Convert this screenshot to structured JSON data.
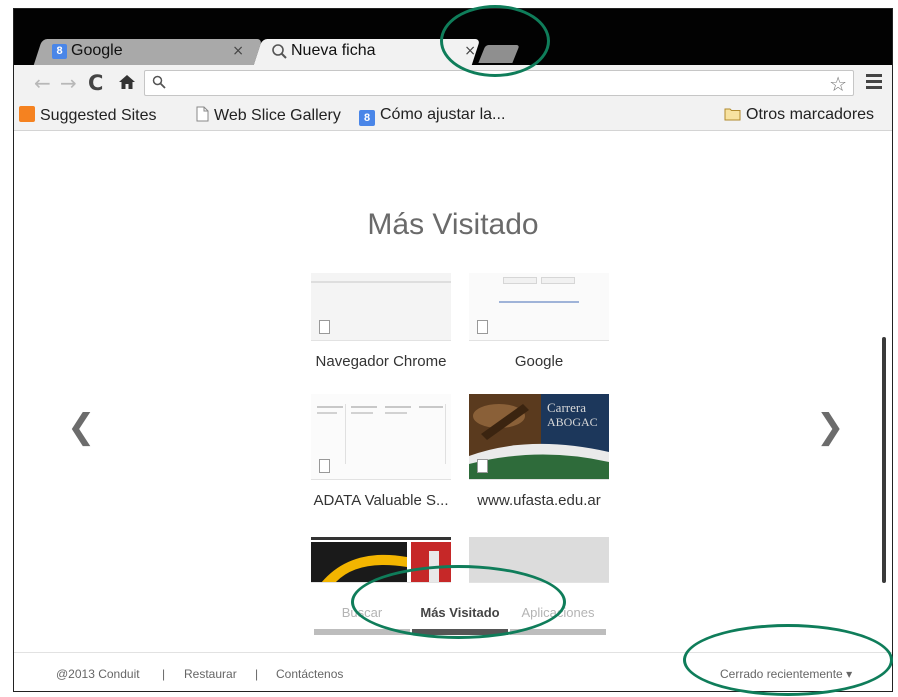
{
  "browser": {
    "tabs": [
      {
        "title": "Google",
        "favicon": "google-g-icon",
        "active": false
      },
      {
        "title": "Nueva ficha",
        "favicon": "search-icon",
        "active": true
      }
    ],
    "tab_close_glyph": "×",
    "omnibox": {
      "value": "",
      "placeholder": ""
    },
    "nav": {
      "back": "←",
      "forward": "→",
      "reload": "C",
      "home": "⌂",
      "star": "☆"
    }
  },
  "bookmarks": {
    "items": [
      {
        "label": "Suggested Sites",
        "icon": "suggested-sites-icon"
      },
      {
        "label": "Web Slice Gallery",
        "icon": "page-icon"
      },
      {
        "label": "Cómo ajustar la...",
        "icon": "google-g-icon"
      }
    ],
    "other": {
      "label": "Otros marcadores",
      "icon": "folder-icon"
    }
  },
  "newtab": {
    "heading": "Más Visitado",
    "prev_arrow": "❮",
    "next_arrow": "❯",
    "tiles": [
      {
        "label": "Navegador Chrome"
      },
      {
        "label": "Google"
      },
      {
        "label": "ADATA Valuable S..."
      },
      {
        "label": "www.ufasta.edu.ar"
      },
      {
        "label": ""
      },
      {
        "label": ""
      }
    ],
    "thumb_text": {
      "ufasta_line1": "Carrera",
      "ufasta_line2": "ABOGAC"
    },
    "bottom_tabs": [
      {
        "label": "Buscar",
        "active": false
      },
      {
        "label": "Más Visitado",
        "active": true
      },
      {
        "label": "Aplicaciones",
        "active": false
      }
    ]
  },
  "footer": {
    "copyright": "@2013 Conduit",
    "separator": "|",
    "restore": "Restaurar",
    "contact": "Contáctenos",
    "recently_closed": "Cerrado recientemente ▾"
  },
  "colors": {
    "annotation_ring": "#0f7d5a",
    "tabstrip": "#020202",
    "toolbar": "#f2f2f2",
    "heading": "#6a6a6a"
  }
}
